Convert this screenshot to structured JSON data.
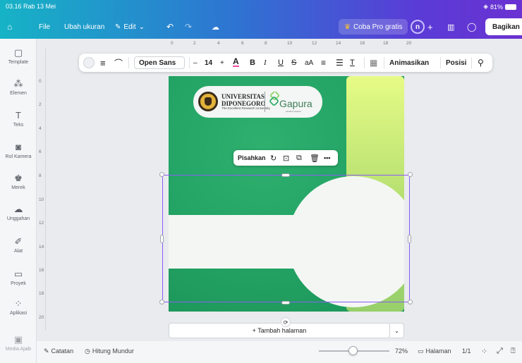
{
  "status": {
    "time_date": "03.16  Rab 13 Mei",
    "battery": "81%"
  },
  "topbar": {
    "file": "File",
    "resize": "Ubah ukuran",
    "edit": "Edit",
    "pro": "Coba Pro gratis",
    "avatar_initial": "n",
    "share": "Bagikan"
  },
  "ruler_top": [
    "0",
    "2",
    "4",
    "6",
    "8",
    "10",
    "12",
    "14",
    "16",
    "18",
    "20"
  ],
  "ruler_left": [
    "0",
    "2",
    "4",
    "6",
    "8",
    "10",
    "12",
    "14",
    "16",
    "18",
    "20"
  ],
  "sidebar": [
    {
      "label": "Template",
      "icon": "template-icon"
    },
    {
      "label": "Elemen",
      "icon": "elements-icon"
    },
    {
      "label": "Teks",
      "icon": "text-icon"
    },
    {
      "label": "Rol Kamera",
      "icon": "camera-icon"
    },
    {
      "label": "Merek",
      "icon": "brand-icon"
    },
    {
      "label": "Unggahan",
      "icon": "upload-icon"
    },
    {
      "label": "Alat",
      "icon": "tools-icon"
    },
    {
      "label": "Proyek",
      "icon": "folder-icon"
    },
    {
      "label": "Aplikasi",
      "icon": "apps-icon"
    },
    {
      "label": "Media Ajaib",
      "icon": "magic-media-icon"
    }
  ],
  "format_toolbar": {
    "font": "Open Sans",
    "minus": "–",
    "font_size": "14",
    "plus": "+",
    "bold": "B",
    "italic": "I",
    "underline": "U",
    "strike": "S",
    "case": "aA",
    "animate": "Animasikan",
    "position": "Posisi"
  },
  "design": {
    "uni_line1": "UNIVERSITAS",
    "uni_line2": "DIPONEGORO",
    "uni_tagline": "The Excellent Research University",
    "gapura": "Gapura",
    "gapura_sub": "sahabat sejawat"
  },
  "context_menu": {
    "split": "Pisahkan",
    "more": "•••"
  },
  "add_page": "+ Tambah halaman",
  "bottom": {
    "notes": "Catatan",
    "timer": "Hitung Mundur",
    "zoom": "72%",
    "pages_label": "Halaman",
    "page_count": "1/1"
  },
  "colors": {
    "accent": "#8b5cf6",
    "page_green": "#22a263",
    "lime": "#d6f27c"
  }
}
